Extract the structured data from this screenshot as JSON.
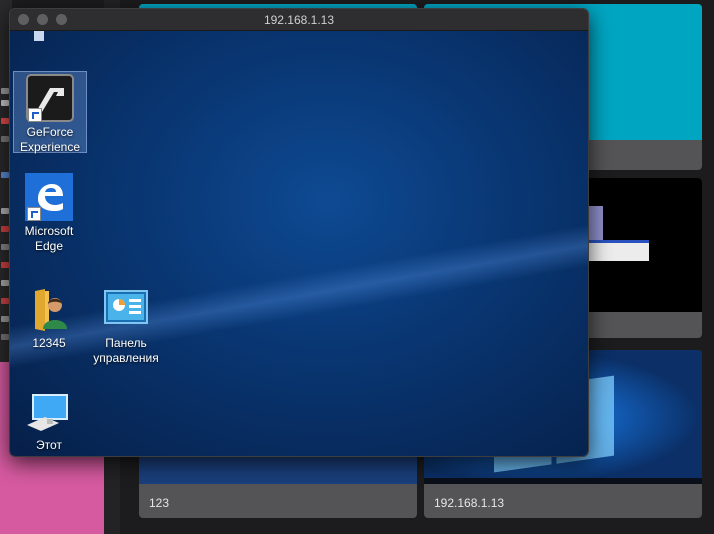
{
  "window": {
    "title": "192.168.1.13"
  },
  "desktop_icons": [
    {
      "label": "GeForce Experience",
      "icon": "geforce-experience-icon"
    },
    {
      "label": "Microsoft Edge",
      "icon": "edge-icon"
    },
    {
      "label": "12345",
      "icon": "user-folder-icon"
    },
    {
      "label": "Панель управления",
      "icon": "control-panel-icon"
    },
    {
      "label": "Этот компьютер",
      "icon": "this-pc-icon"
    }
  ],
  "thumbnails": [
    {
      "label": "",
      "color": "#00a5c2"
    },
    {
      "label": "",
      "color": "#00a5c2"
    },
    {
      "label": "",
      "color": "#000000"
    },
    {
      "label": "",
      "color": "#000000"
    },
    {
      "label": "123",
      "color": "#1a3f7c"
    },
    {
      "label": "192.168.1.13",
      "color": "#0b2f66"
    }
  ],
  "colors": {
    "accent_pink": "#d65aa0",
    "thumb_cyan": "#00a5c2",
    "desktop_blue": "#0a3a7a"
  }
}
